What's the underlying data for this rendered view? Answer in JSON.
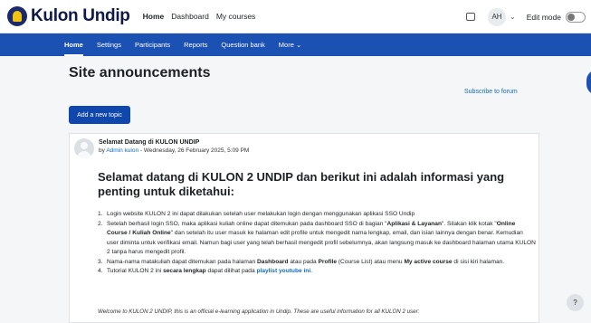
{
  "brand": {
    "name": "Kulon Undip"
  },
  "topnav": {
    "items": [
      {
        "label": "Home"
      },
      {
        "label": "Dashboard"
      },
      {
        "label": "My courses"
      }
    ]
  },
  "user": {
    "initials": "AH",
    "edit_mode_label": "Edit mode"
  },
  "secnav": {
    "items": [
      {
        "label": "Home"
      },
      {
        "label": "Settings"
      },
      {
        "label": "Participants"
      },
      {
        "label": "Reports"
      },
      {
        "label": "Question bank"
      },
      {
        "label": "More"
      }
    ],
    "more_chevron": "⌄"
  },
  "page": {
    "title": "Site announcements",
    "subscribe_label": "Subscribe to forum",
    "add_topic_label": "Add a new topic"
  },
  "post": {
    "subject": "Selamat Datang di KULON UNDIP",
    "by": "by ",
    "author": "Admin kulon",
    "date": " - Wednesday, 26 February 2025, 5:09 PM",
    "heading": "Selamat datang di KULON 2 UNDIP dan berikut ini adalah informasi yang penting untuk diketahui:",
    "items": [
      {
        "num": "1.",
        "text": "Login website KULON 2 ini dapat dilakukan setelah user melakukan login dengan menggunakan aplikasi SSO Undip"
      },
      {
        "num": "2.",
        "t1": "Setelah berhasil login SSO, maka aplikasi kuliah online dapat ditemukan pada dashboard SSO di bagian \"",
        "b1": "Aplikasi & Layanan",
        "t2": "\". Silakan klik kotak \"",
        "b2": "Online Course / Kuliah Online",
        "t3": "\" dan setelah itu user masuk ke halaman edit profile untuk mengedit nama lengkap, email, dan isian lainnya dengan benar. Kemudian user diminta untuk verifikasi email. Namun bagi user yang telah berhasil mengedit profil sebelumnya, akan langsung masuk ke dashboard halaman utama KULON 2 tanpa harus mengedit profil."
      },
      {
        "num": "3.",
        "t1": "Nama-nama matakuliah dapat ditemukan pada halaman ",
        "b1": "Dashboard",
        "t2": " atau pada ",
        "b2": "Profile",
        "t3": " (Course List) atau menu ",
        "b3": "My active course",
        "t4": " di sisi kiri halaman."
      },
      {
        "num": "4.",
        "t1": "Tutorial KULON 2 ini ",
        "b1": "secara lengkap",
        "t2": " dapat dilihat pada ",
        "link": "playlist youtube ini",
        "t3": "."
      }
    ],
    "welcome": "Welcome to KULON 2 UNDIP, this is an official e-learning application in Undip. These are useful information for all KULON 2 user:"
  },
  "help": {
    "label": "?"
  }
}
